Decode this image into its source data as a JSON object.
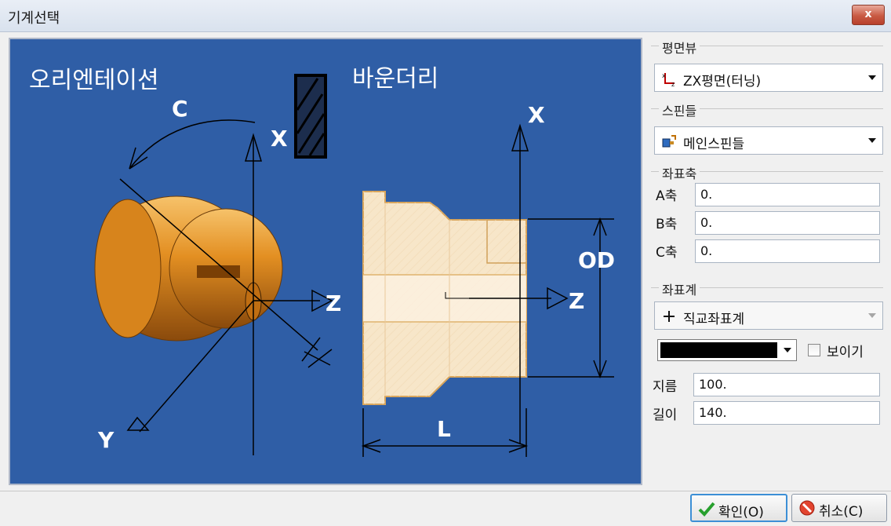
{
  "window": {
    "title": "기계선택",
    "close_label": "x"
  },
  "preview": {
    "orientation_label": "오리엔테이션",
    "boundary_label": "바운더리",
    "axis_c": "C",
    "axis_x_left": "X",
    "axis_z_left": "Z",
    "axis_y": "Y",
    "axis_x_right": "X",
    "axis_z_right": "Z",
    "dim_od": "OD",
    "dim_l": "L"
  },
  "plane_view": {
    "header": "평면뷰",
    "value": "ZX평면(터닝)",
    "icon": "zx-axis-icon"
  },
  "spindle": {
    "header": "스핀들",
    "value": "메인스핀들",
    "icon": "spindle-icon"
  },
  "axes": {
    "header": "좌표축",
    "a_label": "A축",
    "a_value": "0.",
    "b_label": "B축",
    "b_value": "0.",
    "c_label": "C축",
    "c_value": "0."
  },
  "coord_system": {
    "header": "좌표계",
    "value": "직교좌표계",
    "icon": "crosshair-icon",
    "color": "#000000",
    "show_label": "보이기",
    "show_checked": false,
    "diameter_label": "지름",
    "diameter_value": "100.",
    "length_label": "길이",
    "length_value": "140."
  },
  "buttons": {
    "ok": "확인(O)",
    "cancel": "취소(C)"
  }
}
